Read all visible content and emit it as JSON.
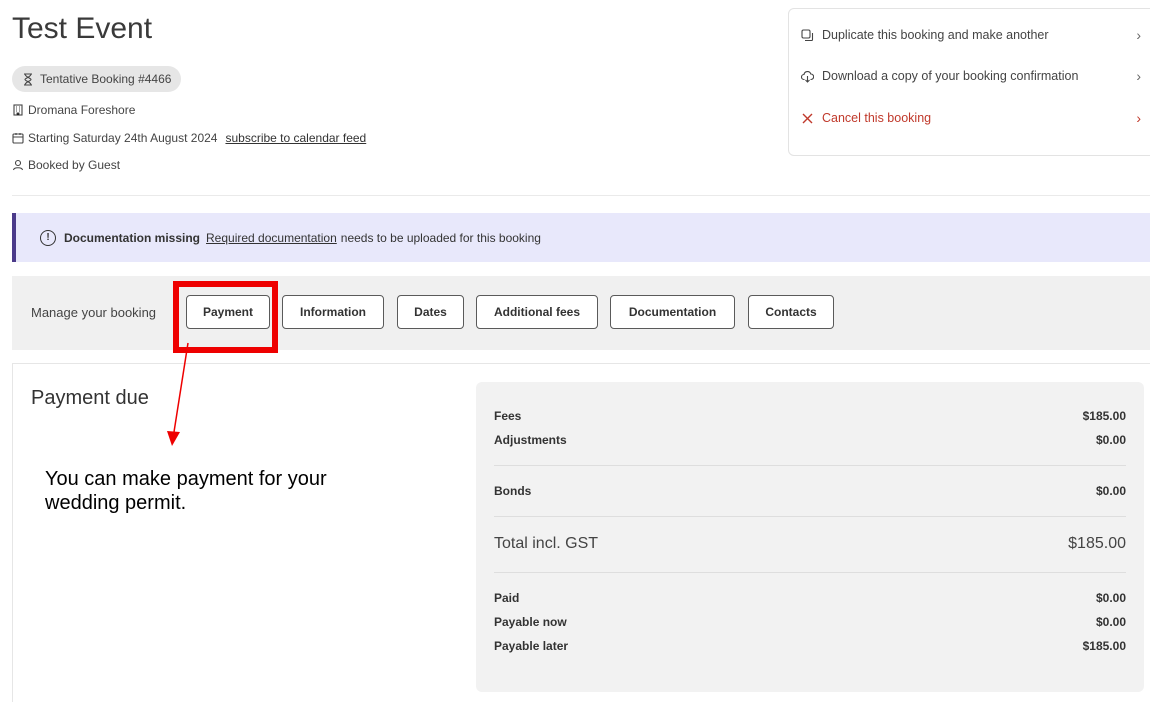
{
  "page": {
    "title": "Test Event",
    "status_badge": "Tentative Booking #4466",
    "location": "Dromana Foreshore",
    "starting": "Starting Saturday 24th August 2024",
    "subscribe_link": "subscribe to calendar feed",
    "booked_by": "Booked by Guest"
  },
  "actions": [
    {
      "label": "Duplicate this booking and make another",
      "icon": "copy-icon"
    },
    {
      "label": "Download a copy of your booking confirmation",
      "icon": "cloud-download-icon"
    },
    {
      "label": "Cancel this booking",
      "icon": "close-icon"
    }
  ],
  "alert": {
    "heading": "Documentation missing",
    "link": "Required documentation",
    "text": "needs to be uploaded for this booking"
  },
  "manage": {
    "label": "Manage your booking",
    "tabs": [
      "Payment",
      "Information",
      "Dates",
      "Additional fees",
      "Documentation",
      "Contacts"
    ]
  },
  "payment": {
    "title": "Payment due",
    "annotation": "You can make payment for your wedding permit.",
    "rows": [
      {
        "label": "Fees",
        "value": "$185.00"
      },
      {
        "label": "Adjustments",
        "value": "$0.00"
      },
      {
        "label": "Bonds",
        "value": "$0.00"
      },
      {
        "label": "Total incl. GST",
        "value": "$185.00"
      },
      {
        "label": "Paid",
        "value": "$0.00"
      },
      {
        "label": "Payable now",
        "value": "$0.00"
      },
      {
        "label": "Payable later",
        "value": "$185.00"
      }
    ]
  },
  "colors": {
    "alert_bg": "#e8e8fb",
    "alert_accent": "#4b3a8a",
    "danger": "#c0392b",
    "highlight": "#ee0000"
  }
}
